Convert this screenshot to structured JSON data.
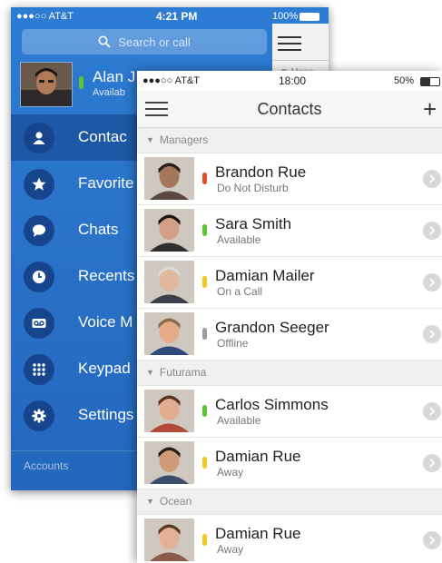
{
  "back_phone": {
    "status": {
      "carrier": "●●●○○ AT&T",
      "time": "4:21 PM",
      "battery": "100%"
    },
    "search_placeholder": "Search or call",
    "profile": {
      "name": "Alan J",
      "status": "Availab",
      "status_color": "#5ec335"
    },
    "peek_text": "▼ Mana",
    "menu": [
      {
        "label": "Contac",
        "icon": "person-icon",
        "active": true
      },
      {
        "label": "Favorite",
        "icon": "star-icon",
        "active": false
      },
      {
        "label": "Chats",
        "icon": "chat-bubble-icon",
        "active": false
      },
      {
        "label": "Recents",
        "icon": "clock-icon",
        "active": false
      },
      {
        "label": "Voice M",
        "icon": "voicemail-icon",
        "active": false
      },
      {
        "label": "Keypad",
        "icon": "keypad-icon",
        "active": false
      },
      {
        "label": "Settings",
        "icon": "gear-icon",
        "active": false
      }
    ],
    "accounts_label": "Accounts"
  },
  "front_phone": {
    "status": {
      "carrier": "●●●○○ AT&T",
      "time": "18:00",
      "battery": "50%"
    },
    "title": "Contacts",
    "add_label": "+",
    "sections": [
      {
        "title": "Managers",
        "contacts": [
          {
            "name": "Brandon Rue",
            "status": "Do Not Disturb",
            "dot": "#e4502a",
            "skin": "#a5775a",
            "hair": "#2a1e17",
            "shirt": "#5a4840"
          },
          {
            "name": "Sara Smith",
            "status": "Available",
            "dot": "#5ec335",
            "skin": "#d3a087",
            "hair": "#1f1612",
            "shirt": "#2e2e2e"
          },
          {
            "name": "Damian Mailer",
            "status": "On a Call",
            "dot": "#f3c623",
            "skin": "#e2b89c",
            "hair": "#d9d9d9",
            "shirt": "#3b3f4a"
          },
          {
            "name": "Grandon Seeger",
            "status": "Offline",
            "dot": "#9c9c9c",
            "skin": "#e5aa86",
            "hair": "#8a6a48",
            "shirt": "#2f4a7a"
          }
        ]
      },
      {
        "title": "Futurama",
        "contacts": [
          {
            "name": "Carlos Simmons",
            "status": "Available",
            "dot": "#5ec335",
            "skin": "#e2ad8e",
            "hair": "#5a3320",
            "shirt": "#b24a3a"
          },
          {
            "name": "Damian Rue",
            "status": "Away",
            "dot": "#f3c623",
            "skin": "#cf9a78",
            "hair": "#2a1e17",
            "shirt": "#3a4d6a"
          }
        ]
      },
      {
        "title": "Ocean",
        "contacts": [
          {
            "name": "Damian Rue",
            "status": "Away",
            "dot": "#f3c623",
            "skin": "#e3b194",
            "hair": "#5a3a22",
            "shirt": "#8a5a4a"
          }
        ]
      }
    ]
  }
}
